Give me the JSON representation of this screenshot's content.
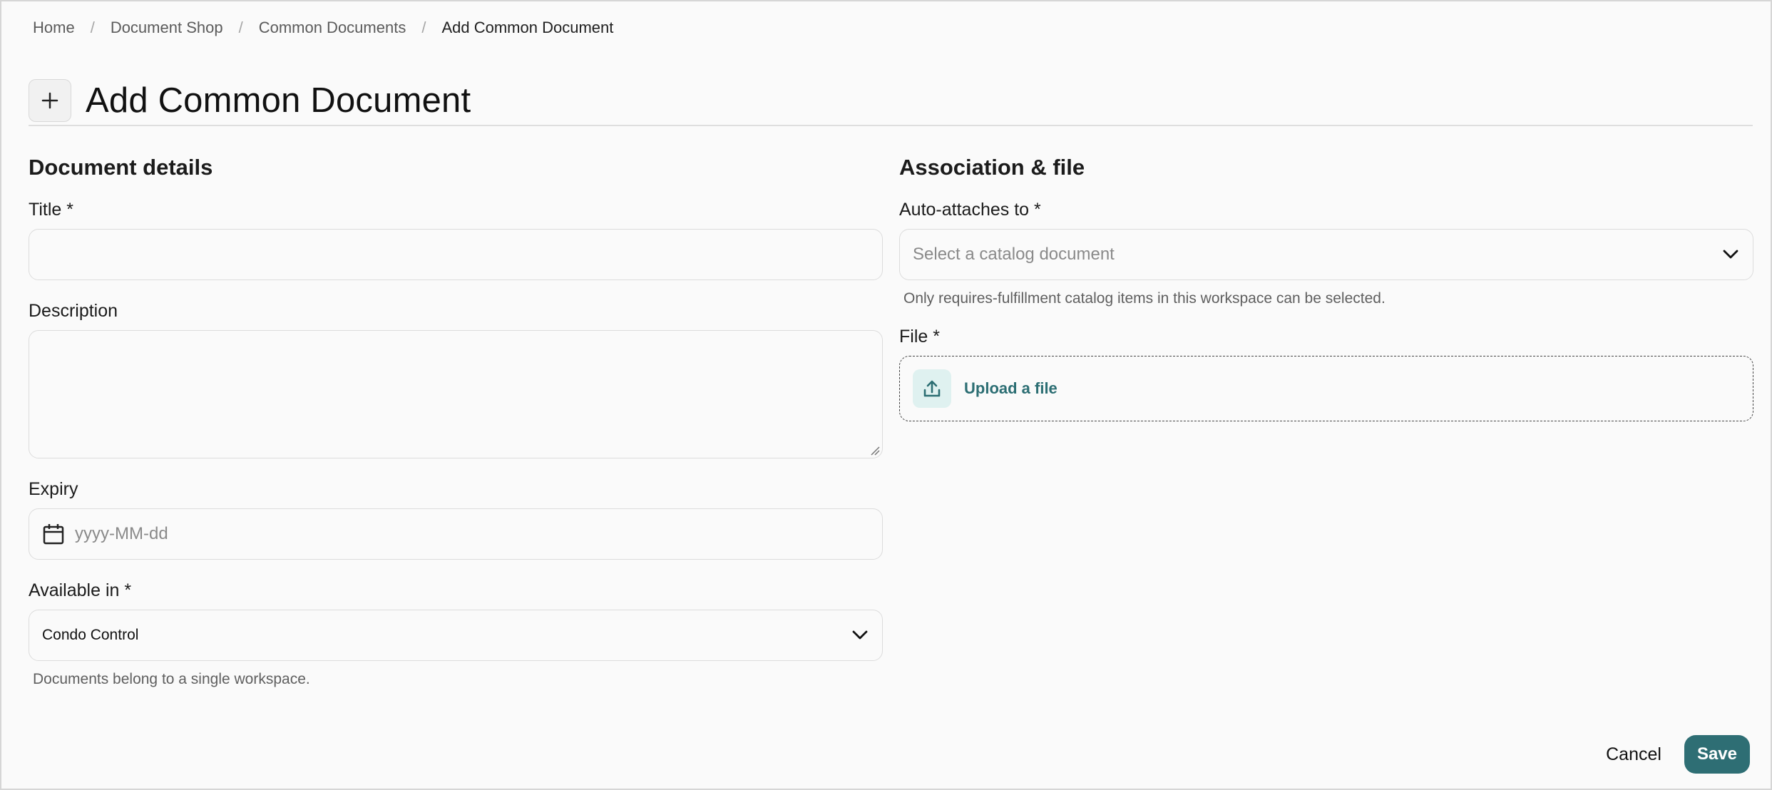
{
  "breadcrumb": [
    "Home",
    "Document Shop",
    "Common Documents",
    "Add Common Document"
  ],
  "page_title": "Add Common Document",
  "left": {
    "section_title": "Document details",
    "title_label": "Title *",
    "title_value": "",
    "description_label": "Description",
    "description_value": "",
    "expiry_label": "Expiry",
    "expiry_placeholder": "yyyy-MM-dd",
    "available_label": "Available in *",
    "available_value": "Condo Control",
    "available_help": "Documents belong to a single workspace."
  },
  "right": {
    "section_title": "Association & file",
    "auto_label": "Auto-attaches to *",
    "auto_placeholder": "Select a catalog document",
    "auto_help": "Only requires-fulfillment catalog items in this workspace can be selected.",
    "file_label": "File *",
    "upload_text": "Upload a file"
  },
  "actions": {
    "cancel": "Cancel",
    "save": "Save"
  },
  "colors": {
    "accent": "#2e6e74",
    "upload_bg": "#dff1f0"
  },
  "icons": {
    "add": "plus-icon",
    "calendar": "calendar-icon",
    "chevron": "chevron-down-icon",
    "upload": "upload-icon"
  }
}
